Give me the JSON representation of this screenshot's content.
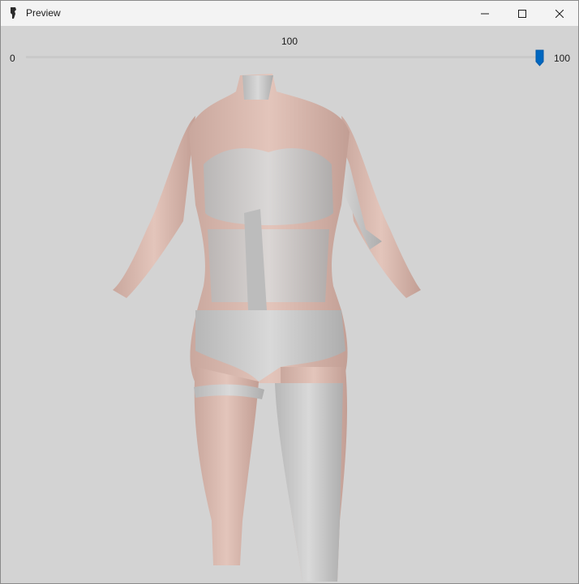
{
  "window": {
    "title": "Preview",
    "icon": "app-figure-icon",
    "controls": [
      "minimize-icon",
      "maximize-icon",
      "close-icon"
    ]
  },
  "slider": {
    "value_label": "100",
    "min_label": "0",
    "max_label": "100",
    "value": 100,
    "min": 0,
    "max": 100,
    "accent": "#0067c0"
  },
  "viewport": {
    "content": "3d-model-preview",
    "background": "#d3d3d3"
  }
}
